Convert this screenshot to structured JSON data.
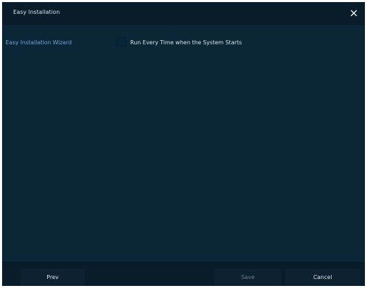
{
  "window": {
    "title": "Easy Installation",
    "close_label": "×"
  },
  "content": {
    "wizard_label": "Easy Installation Wizard",
    "run_every_time_label": "Run Every Time when the System Starts"
  },
  "footer": {
    "prev_label": "Prev",
    "save_label": "Save",
    "cancel_label": "Cancel"
  },
  "colors": {
    "window_bg": "#0b2637",
    "titlebar_bg": "#091c2a",
    "label_blue": "#6ea7d8",
    "footer_bg": "#081c29"
  }
}
